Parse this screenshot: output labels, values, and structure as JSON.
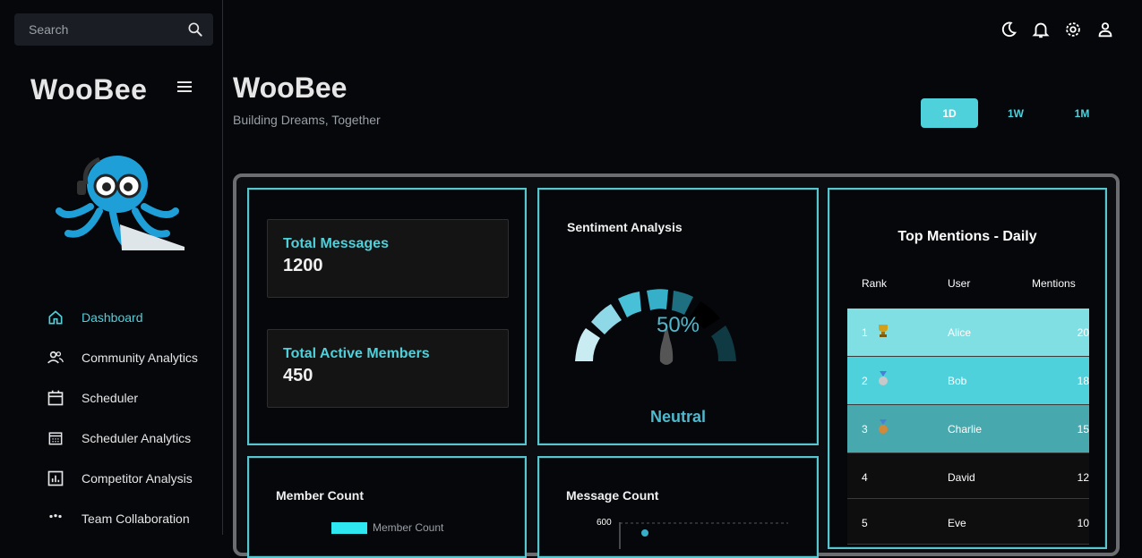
{
  "search": {
    "placeholder": "Search"
  },
  "sidebar": {
    "brand": "WooBee",
    "items": [
      {
        "label": "Dashboard",
        "icon": "home-icon",
        "active": true
      },
      {
        "label": "Community Analytics",
        "icon": "people-icon"
      },
      {
        "label": "Scheduler",
        "icon": "calendar-icon"
      },
      {
        "label": "Scheduler Analytics",
        "icon": "calendar-grid-icon"
      },
      {
        "label": "Competitor Analysis",
        "icon": "bar-chart-icon"
      },
      {
        "label": "Team Collaboration",
        "icon": "team-icon"
      }
    ]
  },
  "header": {
    "title": "WooBee",
    "subtitle": "Building Dreams, Together"
  },
  "range": {
    "options": [
      "1D",
      "1W",
      "1M"
    ],
    "selected": "1D"
  },
  "stats": {
    "messages_label": "Total Messages",
    "messages_value": "1200",
    "members_label": "Total Active Members",
    "members_value": "450"
  },
  "sentiment": {
    "title": "Sentiment Analysis",
    "value": "50%",
    "label": "Neutral",
    "level": 0.5
  },
  "mentions": {
    "title": "Top Mentions - Daily",
    "headers": [
      "Rank",
      "User",
      "Mentions"
    ],
    "rows": [
      {
        "rank": "1",
        "user": "Alice",
        "mentions": "20",
        "medal": "trophy-icon"
      },
      {
        "rank": "2",
        "user": "Bob",
        "mentions": "18",
        "medal": "silver-medal-icon"
      },
      {
        "rank": "3",
        "user": "Charlie",
        "mentions": "15",
        "medal": "bronze-medal-icon"
      },
      {
        "rank": "4",
        "user": "David",
        "mentions": "12"
      },
      {
        "rank": "5",
        "user": "Eve",
        "mentions": "10"
      }
    ]
  },
  "member_count": {
    "title": "Member Count",
    "legend": "Member Count"
  },
  "message_count": {
    "title": "Message Count",
    "axis_top": "600"
  },
  "colors": {
    "accent": "#4fd1dc",
    "row1": "#7fdfe3",
    "row2": "#4fd1dc",
    "row3": "#47a9ad",
    "row_dark": "#0e0e0e"
  }
}
